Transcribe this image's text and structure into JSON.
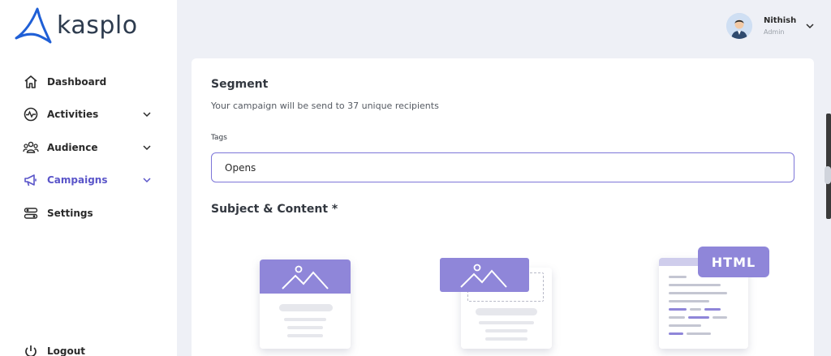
{
  "brand": {
    "name": "kasplo"
  },
  "sidebar": {
    "items": [
      {
        "label": "Dashboard"
      },
      {
        "label": "Activities"
      },
      {
        "label": "Audience"
      },
      {
        "label": "Campaigns"
      },
      {
        "label": "Settings"
      }
    ],
    "logout_label": "Logout"
  },
  "user": {
    "name": "Nithish",
    "role": "Admin"
  },
  "segment": {
    "title": "Segment",
    "description": "Your campaign will be send to 37 unique recipients",
    "tags_label": "Tags",
    "tags_value": "Opens"
  },
  "content": {
    "title": "Subject & Content *",
    "html_badge": "HTML"
  },
  "colors": {
    "accent": "#5a55c9",
    "illustration": "#8f86d9",
    "background": "#eef0f6"
  }
}
